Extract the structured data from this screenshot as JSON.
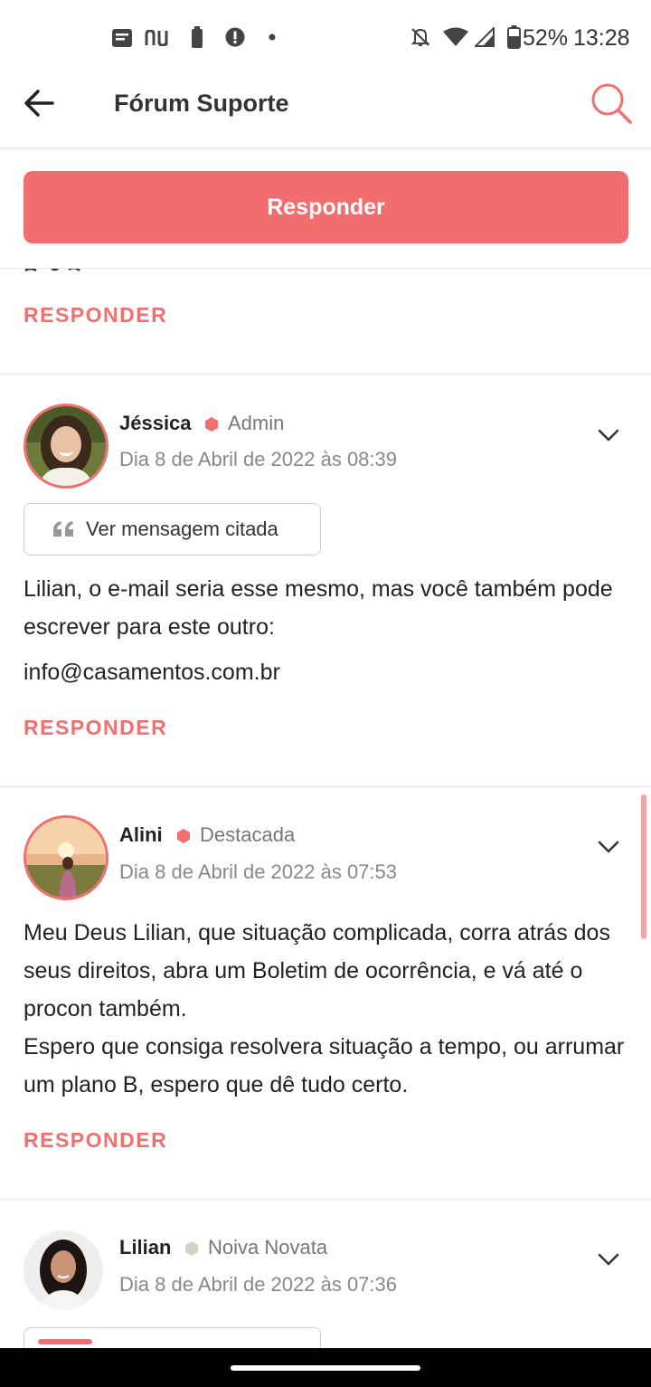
{
  "status_bar": {
    "battery": "52%",
    "time": "13:28",
    "left_icons": [
      "message-icon",
      "nubank-icon",
      "battery-saver-icon",
      "alert-icon",
      "dot-icon"
    ],
    "right_icons": [
      "mute-icon",
      "wifi-icon",
      "signal-icon",
      "battery-icon"
    ]
  },
  "header": {
    "title": "Fórum Suporte"
  },
  "reply_bar": {
    "label": "Responder"
  },
  "colors": {
    "accent": "#f26d6d",
    "text_primary": "#222222",
    "text_muted": "#888888",
    "divider": "#e6e6e6"
  },
  "fragment": {
    "responder": "RESPONDER"
  },
  "posts": [
    {
      "author": "Jéssica",
      "role": "Admin",
      "role_color": "#f07070",
      "date": "Dia 8 de Abril de 2022 às 08:39",
      "quote_label": "Ver mensagem citada",
      "body_1": "Lilian, o e-mail seria esse mesmo, mas você também pode escrever para este outro:",
      "body_2": "info@casamentos.com.br",
      "responder": "RESPONDER"
    },
    {
      "author": "Alini",
      "role": "Destacada",
      "role_color": "#f07070",
      "date": "Dia 8 de Abril de 2022 às 07:53",
      "body_1": "Meu Deus Lilian, que situação complicada, corra atrás dos seus direitos, abra um Boletim de ocorrência, e vá até o procon também.",
      "body_2": "Espero que consiga resolvera situação a tempo, ou arrumar um plano B, espero que dê tudo certo.",
      "responder": "RESPONDER"
    },
    {
      "author": "Lilian",
      "role": "Noiva Novata",
      "role_color": "#d8d0c4",
      "date": "Dia 8 de Abril de 2022 às 07:36"
    }
  ]
}
